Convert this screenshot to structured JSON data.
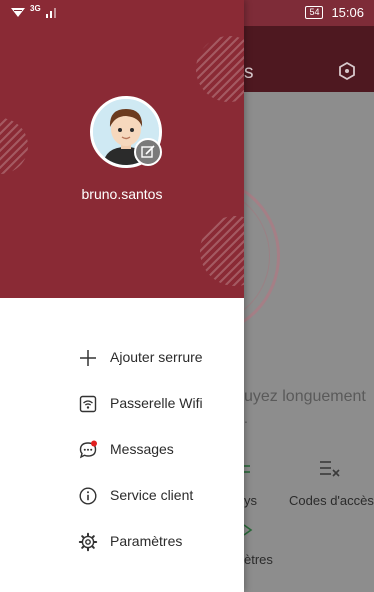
{
  "status_bar": {
    "network": "3G",
    "battery": "54",
    "time": "15:06"
  },
  "background_app": {
    "title_fragment": "s",
    "hint_fragment": "uyez longuement",
    "hint_fragment_2": ".",
    "tab_keys_label": "ys",
    "tab_codes_label": "Codes d'accès",
    "tab_settings_label": "ètres"
  },
  "drawer": {
    "username": "bruno.santos",
    "menu": [
      {
        "label": "Ajouter serrure",
        "icon": "plus-icon"
      },
      {
        "label": "Passerelle Wifi",
        "icon": "wifi-gateway-icon"
      },
      {
        "label": "Messages",
        "icon": "message-icon"
      },
      {
        "label": "Service client",
        "icon": "info-icon"
      },
      {
        "label": "Paramètres",
        "icon": "gear-icon"
      }
    ]
  },
  "colors": {
    "primary": "#8a2a35",
    "dark_header": "#4e1820",
    "unread_dot": "#e02020"
  }
}
